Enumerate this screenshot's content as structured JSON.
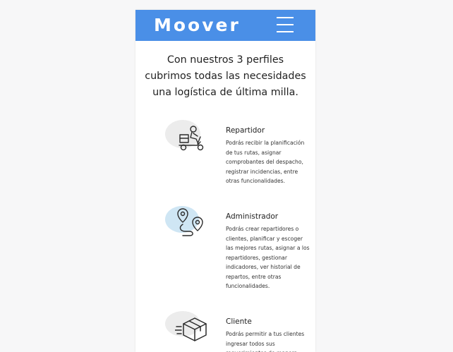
{
  "header": {
    "brand": "Moover",
    "menu_icon": "hamburger-menu-icon",
    "background_color": "#4a8fe7"
  },
  "intro": {
    "text": "Con nuestros 3 perfiles cubrimos todas las necesidades una logística de última milla."
  },
  "profiles": [
    {
      "icon": "delivery-scooter-icon",
      "title": "Repartidor",
      "description": "Podrás recibir la planificación de tus rutas, asignar comprobantes del despacho, registrar incidencias, entre otras funcionalidades."
    },
    {
      "icon": "route-pins-icon",
      "title": "Administrador",
      "description": "Podrás crear repartidores o clientes, planificar y escoger las mejores rutas, asignar a los repartidores, gestionar indicadores, ver historial de repartos, entre otras funcionalidades."
    },
    {
      "icon": "fast-package-icon",
      "title": "Cliente",
      "description": "Podrás permitir a tus clientes ingresar todos sus requerimientos de manera individual o masiva"
    }
  ]
}
